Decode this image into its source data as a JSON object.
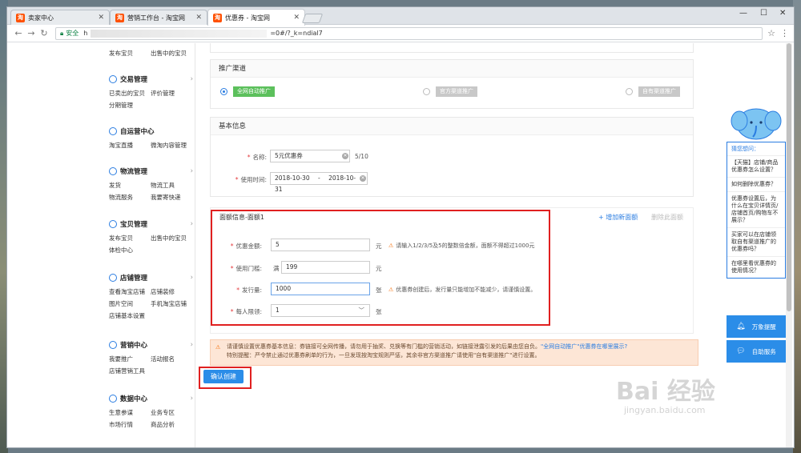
{
  "browser": {
    "tabs": [
      {
        "favicon": "淘",
        "title": "卖家中心"
      },
      {
        "favicon": "淘",
        "title": "营销工作台 - 淘宝网"
      },
      {
        "favicon": "淘",
        "title": "优惠券 - 淘宝网"
      }
    ],
    "address": {
      "secure_label": "安全",
      "url_prefix": "h",
      "url_suffix": "=0#/?_k=ndial7"
    }
  },
  "sidebar": {
    "top_links": [
      "发布宝贝",
      "出售中的宝贝"
    ],
    "groups": [
      {
        "title": "交易管理",
        "links": [
          "已卖出的宝贝",
          "评价管理",
          "分期管理"
        ]
      },
      {
        "title": "自运营中心",
        "links": [
          "淘宝直播",
          "微淘内容管理"
        ]
      },
      {
        "title": "物流管理",
        "links": [
          "发货",
          "物流工具",
          "物流服务",
          "我要寄快递"
        ]
      },
      {
        "title": "宝贝管理",
        "links": [
          "发布宝贝",
          "出售中的宝贝",
          "体检中心"
        ]
      },
      {
        "title": "店铺管理",
        "links": [
          "查看淘宝店铺",
          "店铺装修",
          "图片空间",
          "手机淘宝店铺",
          "店铺基本设置"
        ]
      },
      {
        "title": "营销中心",
        "links": [
          "我要推广",
          "活动报名",
          "店铺营销工具"
        ]
      },
      {
        "title": "数据中心",
        "links": [
          "生意参谋",
          "业务专区",
          "市场行情",
          "商品分析"
        ]
      }
    ]
  },
  "channel": {
    "title": "推广渠道",
    "options": [
      "全网自动推广",
      "官方渠道推广",
      "自有渠道推广"
    ],
    "selected_index": 0
  },
  "basic": {
    "title": "基本信息",
    "name_label": "名称:",
    "name_value": "5元优惠券",
    "name_count": "5/10",
    "time_label": "使用时间:",
    "start_date": "2018-10-30",
    "date_sep": "-",
    "end_date": "2018-10-31"
  },
  "amount": {
    "title": "面额信息-面额1",
    "add_link": "+ 增加新面额",
    "delete_link": "删除此面额",
    "face_label": "优惠金额:",
    "face_value": "5",
    "face_unit": "元",
    "face_hint": "请输入1/2/3/5及5的整数倍金额，面额不得超过1000元",
    "threshold_label": "使用门槛:",
    "threshold_prefix": "满",
    "threshold_value": "199",
    "threshold_unit": "元",
    "qty_label": "发行量:",
    "qty_value": "1000",
    "qty_unit": "张",
    "qty_hint": "优惠券创建后，发行量只能增加不能减少，请谨慎设置。",
    "limit_label": "每人限领:",
    "limit_value": "1",
    "limit_unit": "张"
  },
  "notice": {
    "line1": "请谨慎设置优惠券基本信息：券链接可全网传播，请勿用于抽奖、兑换等有门槛的营销活动，如链接泄露引发的后果由您自负。",
    "line1_link": "\"全网自动推广\"优惠券在哪里展示?",
    "line2": "特别提醒：严令禁止通过优惠券刷单的行为，一旦发现按淘宝规则严惩，其余非官方渠道推广请使用\"自有渠道推广\"进行设置。"
  },
  "confirm_button": "确认创建",
  "helper": {
    "heading": "猜您想问：",
    "questions": [
      "【天猫】店铺/商品优惠券怎么设置？",
      "如何删除优惠券？",
      "优惠券设置后，为什么在宝贝详情页/店铺首页/购物车不展示？",
      "买家可以在店铺领取自有渠道推广的优惠券吗？",
      "在哪里看优惠券的使用情况？"
    ],
    "buttons": [
      {
        "icon": "bell-icon",
        "label": "万象提醒"
      },
      {
        "icon": "chat-icon",
        "label": "自助服务"
      }
    ]
  },
  "watermark": {
    "logo": "Bai 经验",
    "url": "jingyan.baidu.com"
  },
  "colors": {
    "accent": "#2b8de8",
    "highlight_box": "#e02020",
    "chip_on": "#5cc05c",
    "chip_off": "#c8c8c8",
    "warning": "#f56a00"
  }
}
